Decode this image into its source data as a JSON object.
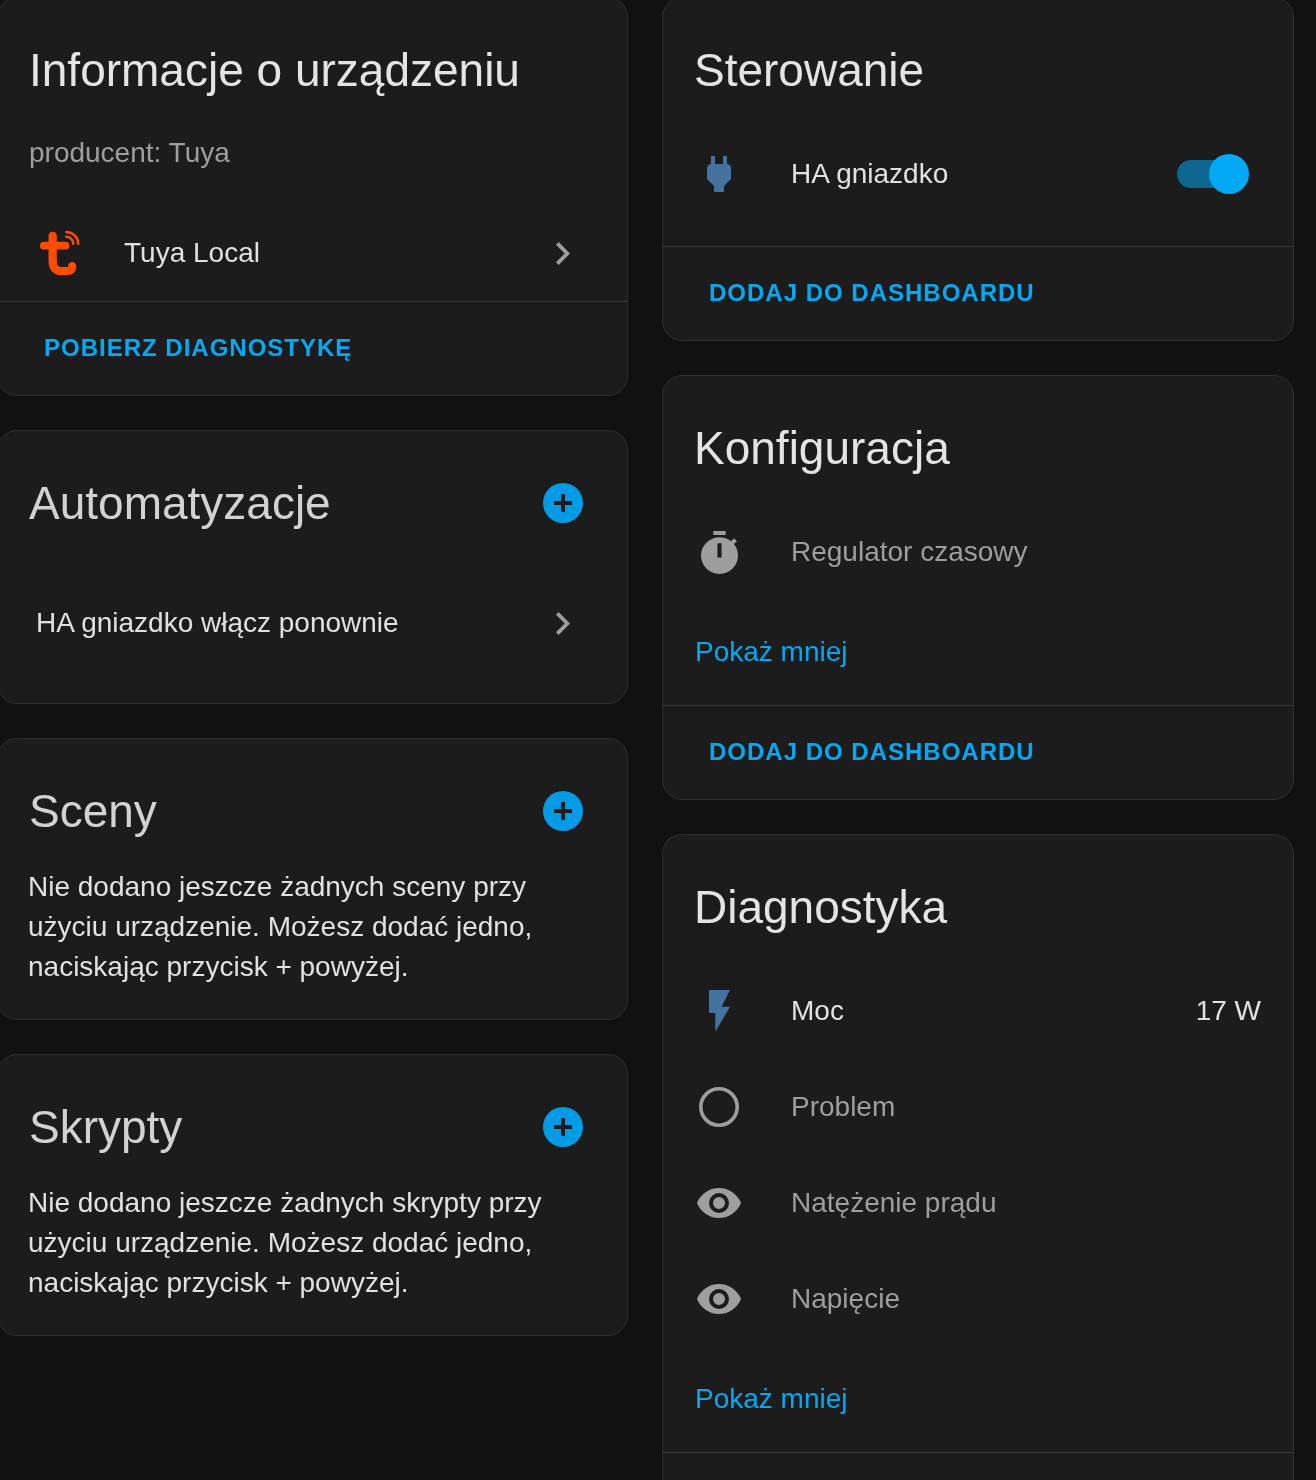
{
  "columns": [
    {
      "cards": [
        {
          "kind": "info",
          "title": "Informacje o urządzeniu",
          "manufacturer": "producent: Tuya",
          "integration": "Tuya Local",
          "actions": [
            "POBIERZ DIAGNOSTYKĘ"
          ]
        },
        {
          "kind": "related",
          "title": "Automatyzacje",
          "items": [
            "HA gniazdko włącz ponownie"
          ]
        },
        {
          "kind": "related",
          "title": "Sceny",
          "empty_text": "Nie dodano jeszcze żadnych sceny przy użyciu urządzenie. Możesz dodać jedno, naciskając przycisk + powyżej."
        },
        {
          "kind": "related",
          "title": "Skrypty",
          "empty_text": "Nie dodano jeszcze żadnych skrypty przy użyciu urządzenie. Możesz dodać jedno, naciskając przycisk + powyżej."
        }
      ]
    },
    {
      "cards": [
        {
          "kind": "entities",
          "title": "Sterowanie",
          "entities": [
            {
              "kind": "switch",
              "name": "HA gniazdko",
              "disabled": false,
              "on": true
            }
          ],
          "actions": [
            "DODAJ DO DASHBOARDU"
          ]
        },
        {
          "kind": "entities",
          "title": "Konfiguracja",
          "entities": [
            {
              "kind": "timer",
              "name": "Regulator czasowy",
              "disabled": true
            }
          ],
          "show_less": "Pokaż mniej",
          "actions": [
            "DODAJ DO DASHBOARDU"
          ]
        },
        {
          "kind": "entities",
          "title": "Diagnostyka",
          "entities": [
            {
              "kind": "power",
              "name": "Moc",
              "value": "17 W",
              "disabled": false
            },
            {
              "kind": "binary",
              "name": "Problem",
              "disabled": true
            },
            {
              "kind": "sensor",
              "name": "Natężenie prądu",
              "disabled": true
            },
            {
              "kind": "sensor",
              "name": "Napięcie",
              "disabled": true
            }
          ],
          "show_less": "Pokaż mniej"
        }
      ]
    }
  ]
}
